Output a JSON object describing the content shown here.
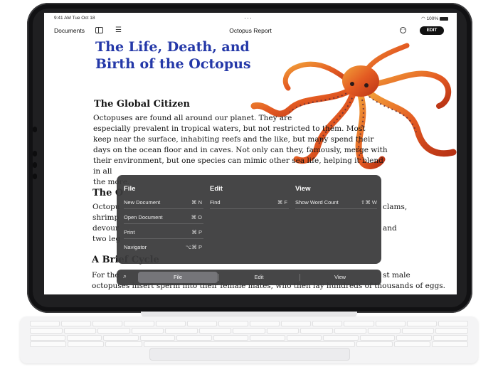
{
  "status_bar": {
    "time": "9:41 AM  Tue Oct 18",
    "right": "100%"
  },
  "navbar": {
    "documents_label": "Documents",
    "title": "Octopus Report",
    "more": "···",
    "edit_label": "EDIT"
  },
  "document": {
    "title_line1": "The Life, Death, and",
    "title_line2": "Birth of the Octopus",
    "sections": [
      {
        "heading": "The Global Citizen",
        "lines": [
          "Octopuses are found all around our planet. They are",
          "especially prevalent in tropical waters, but not restricted to them. Most",
          "keep near the surface, inhabiting reefs and the like, but many spend their",
          "days on the ocean floor and in caves. Not only can they, famously, merge with",
          "their environment, but one species can mimic other sea life, helping it blend in all",
          "the more."
        ]
      },
      {
        "heading": "The O",
        "lines": [
          "Octopu",
          "shrimp",
          "devour",
          "two leg"
        ],
        "right_lines": [
          "clams,",
          "",
          "and",
          ""
        ]
      },
      {
        "heading": "A Brief Cycle",
        "line_left": "For the",
        "line_right": "st male",
        "line2": "octopuses insert sperm into their female mates, who then lay hundreds of thousands of eggs."
      }
    ]
  },
  "menu": {
    "columns": [
      {
        "title": "File",
        "items": [
          {
            "label": "New Document",
            "shortcut": "⌘ N"
          },
          {
            "label": "Open Document",
            "shortcut": "⌘ O"
          },
          {
            "label": "Print",
            "shortcut": "⌘ P"
          },
          {
            "label": "Navigator",
            "shortcut": "⌥⌘ P"
          }
        ]
      },
      {
        "title": "Edit",
        "items": [
          {
            "label": "Find",
            "shortcut": "⌘ F"
          }
        ]
      },
      {
        "title": "View",
        "items": [
          {
            "label": "Show Word Count",
            "shortcut": "⇧⌘ W"
          }
        ]
      }
    ],
    "tabs": {
      "file": "File",
      "edit": "Edit",
      "view": "View"
    }
  },
  "colors": {
    "title_blue": "#2438a8",
    "menu_bg": "#3a3a3c"
  }
}
